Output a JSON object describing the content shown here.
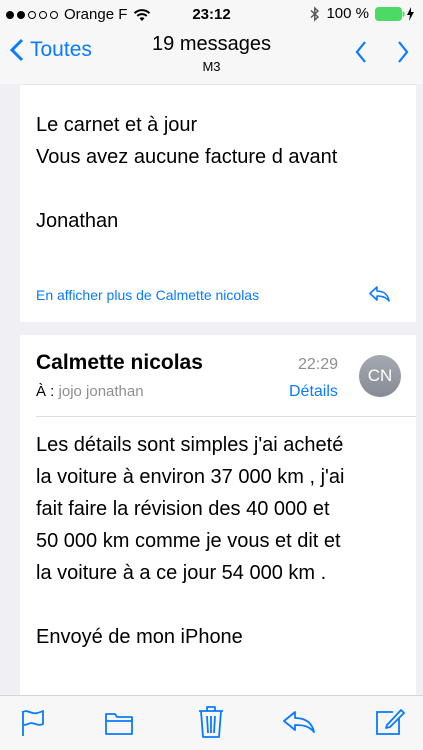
{
  "status_bar": {
    "carrier": "Orange F",
    "time": "23:12",
    "battery": "100 %"
  },
  "nav": {
    "back_label": "Toutes",
    "title": "19 messages",
    "subtitle": "M3"
  },
  "previous_message": {
    "lines": [
      "Le carnet et à jour",
      "Vous avez aucune facture d avant",
      "",
      "Jonathan"
    ],
    "more_link": "En afficher plus de Calmette nicolas"
  },
  "message": {
    "sender": "Calmette nicolas",
    "time": "22:29",
    "to_label": "À :",
    "recipient": "jojo jonathan",
    "details_label": "Détails",
    "avatar_initials": "CN",
    "body_lines": [
      "Les détails sont simples j'ai acheté",
      "la voiture à environ 37 000 km , j'ai",
      "fait faire la révision des 40 000 et",
      "50 000 km comme je vous et dit et",
      "la voiture à a ce jour 54 000 km .",
      "",
      "Envoyé de mon iPhone"
    ]
  },
  "toolbar": {
    "icons": [
      "flag-icon",
      "folder-icon",
      "trash-icon",
      "reply-icon",
      "compose-icon"
    ]
  },
  "colors": {
    "accent": "#0a7aff",
    "background": "#efeff4",
    "bar": "#f7f7f7"
  }
}
